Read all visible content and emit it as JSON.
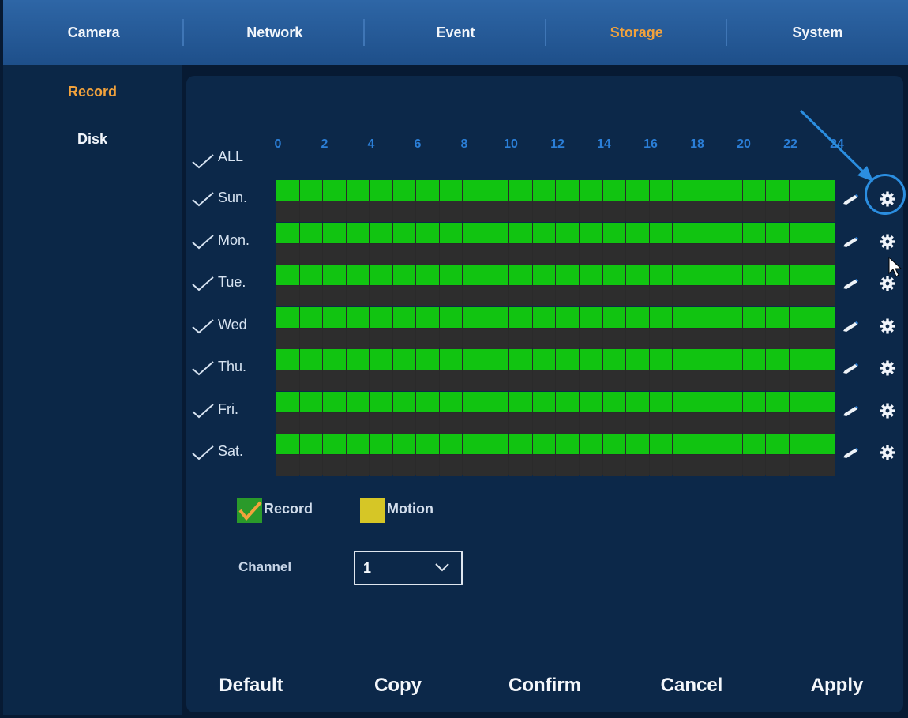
{
  "tabs": [
    {
      "label": "Camera",
      "active": false
    },
    {
      "label": "Network",
      "active": false
    },
    {
      "label": "Event",
      "active": false
    },
    {
      "label": "Storage",
      "active": true
    },
    {
      "label": "System",
      "active": false
    }
  ],
  "sidebar": {
    "items": [
      {
        "label": "Record",
        "active": true
      },
      {
        "label": "Disk",
        "active": false
      }
    ]
  },
  "schedule": {
    "all_label": "ALL",
    "hour_labels": [
      "0",
      "2",
      "4",
      "6",
      "8",
      "10",
      "12",
      "14",
      "16",
      "18",
      "20",
      "22",
      "24"
    ],
    "days": [
      {
        "label": "Sun.",
        "checked": true
      },
      {
        "label": "Mon.",
        "checked": true
      },
      {
        "label": "Tue.",
        "checked": true
      },
      {
        "label": "Wed",
        "checked": true
      },
      {
        "label": "Thu.",
        "checked": true
      },
      {
        "label": "Fri.",
        "checked": true
      },
      {
        "label": "Sat.",
        "checked": true
      }
    ],
    "record_color": "#11c411",
    "empty_color": "#2d2d2d"
  },
  "legend": {
    "record_label": "Record",
    "record_color": "#2a9a2a",
    "motion_label": "Motion",
    "motion_color": "#d6c626"
  },
  "channel": {
    "label": "Channel",
    "value": "1"
  },
  "buttons": {
    "default": "Default",
    "copy": "Copy",
    "confirm": "Confirm",
    "cancel": "Cancel",
    "apply": "Apply"
  },
  "colors": {
    "accent": "#f2a23c",
    "annotation": "#2b8ee0"
  },
  "icons": {
    "edit": "pencil-icon",
    "settings": "gear-icon",
    "check": "check-icon",
    "dropdown": "chevron-down-icon"
  }
}
